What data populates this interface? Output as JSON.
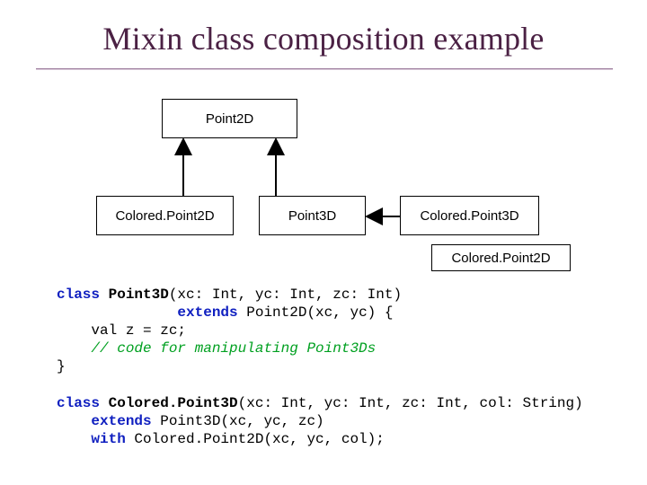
{
  "title": "Mixin class composition example",
  "boxes": {
    "point2d": "Point2D",
    "coloredPoint2d": "Colored.Point2D",
    "point3d": "Point3D",
    "coloredPoint3d": "Colored.Point3D",
    "coloredPoint2dSmall": "Colored.Point2D"
  },
  "code1": {
    "kw_class": "class ",
    "name": "Point3D",
    "sig": "(xc: Int, yc: Int, zc: Int)",
    "indent": "              ",
    "kw_extends": "extends",
    "extends_rest": " Point2D(xc, yc) {",
    "line_valz": "    val z = zc;",
    "comment": "    // code for manipulating Point3Ds",
    "close": "}"
  },
  "code2": {
    "kw_class": "class ",
    "name": "Colored.Point3D",
    "sig": "(xc: Int, yc: Int, zc: Int, col: String)",
    "indent": "    ",
    "kw_extends": "extends",
    "extends_rest": " Point3D(xc, yc, zc)",
    "kw_with": "with",
    "with_rest": " Colored.Point2D(xc, yc, col);"
  }
}
